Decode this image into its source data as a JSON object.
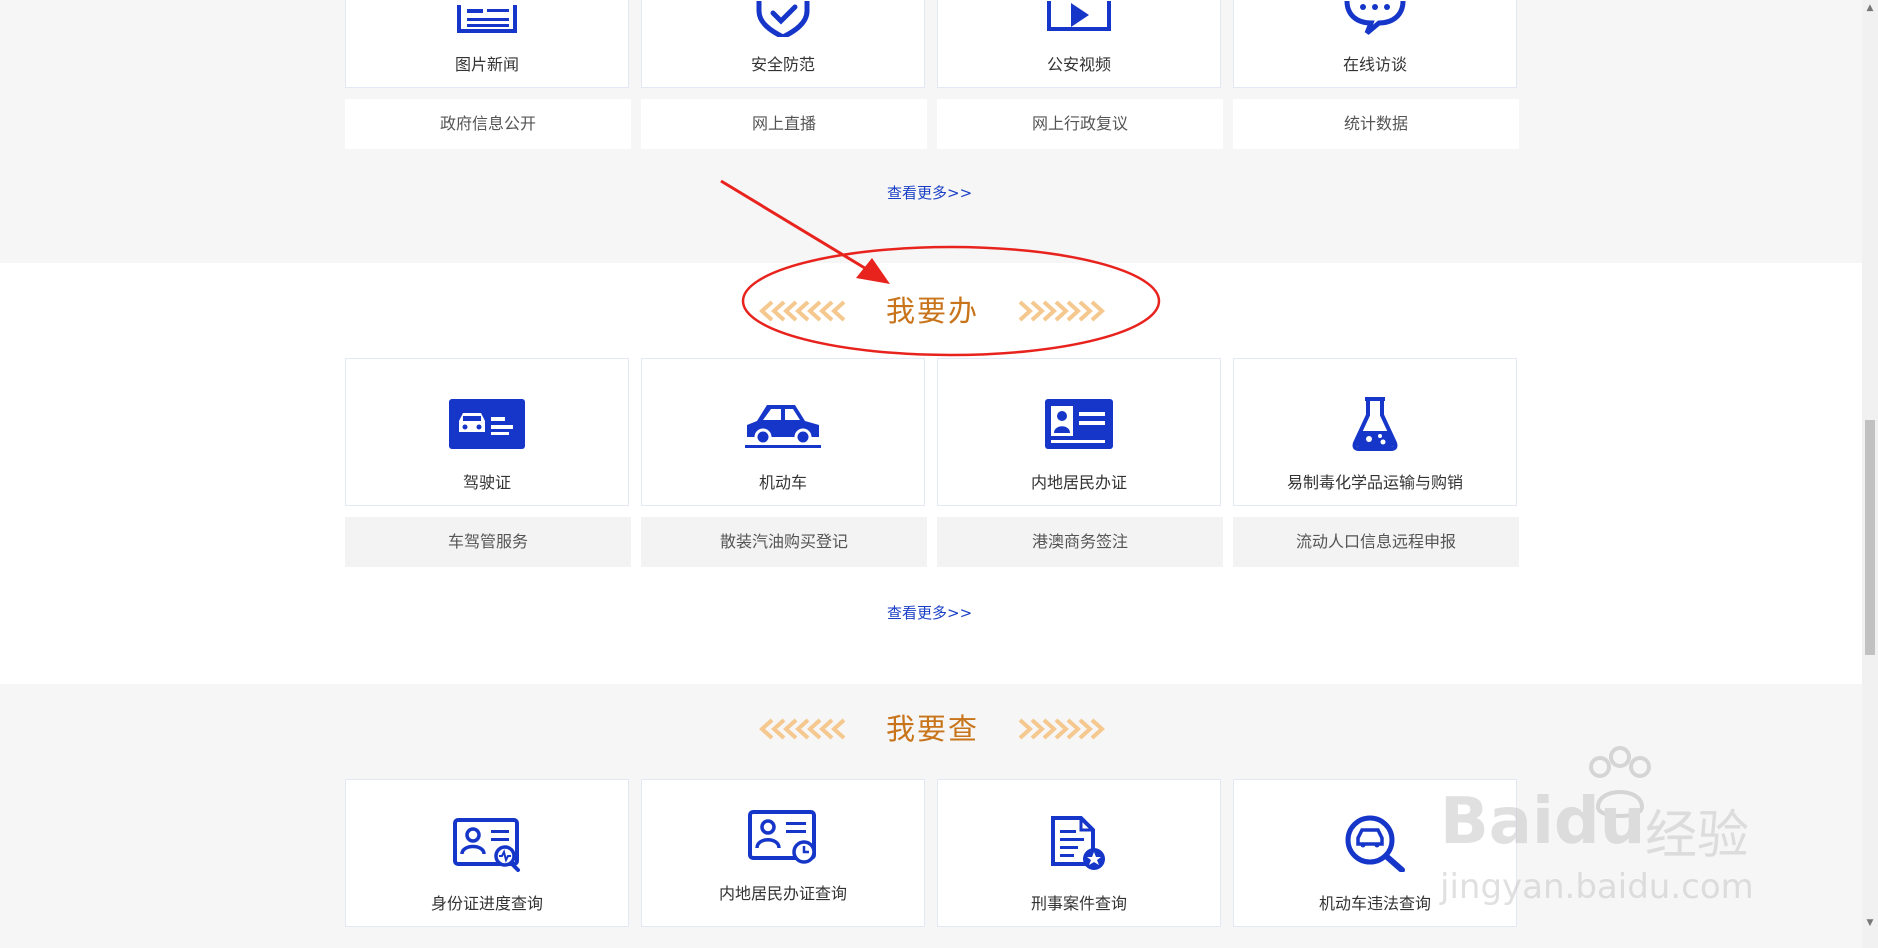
{
  "top_section": {
    "cards": [
      {
        "label": "图片新闻",
        "icon": "news-icon"
      },
      {
        "label": "安全防范",
        "icon": "shield-check-icon"
      },
      {
        "label": "公安视频",
        "icon": "video-play-icon"
      },
      {
        "label": "在线访谈",
        "icon": "chat-bubbles-icon"
      }
    ],
    "subitems": [
      "政府信息公开",
      "网上直播",
      "网上行政复议",
      "统计数据"
    ],
    "more_label": "查看更多>>"
  },
  "banli_section": {
    "title": "我要办",
    "cards": [
      {
        "label": "驾驶证",
        "icon": "driver-license-icon"
      },
      {
        "label": "机动车",
        "icon": "car-icon"
      },
      {
        "label": "内地居民办证",
        "icon": "id-card-icon"
      },
      {
        "label": "易制毒化学品运输与购销",
        "icon": "chemical-flask-icon"
      }
    ],
    "subitems": [
      "车驾管服务",
      "散装汽油购买登记",
      "港澳商务签注",
      "流动人口信息远程申报"
    ],
    "more_label": "查看更多>>"
  },
  "cha_section": {
    "title": "我要查",
    "cards": [
      {
        "label": "身份证进度查询",
        "icon": "id-progress-search-icon"
      },
      {
        "label": "内地居民办证查询",
        "icon": "id-clock-icon"
      },
      {
        "label": "刑事案件查询",
        "icon": "document-star-icon"
      },
      {
        "label": "机动车违法查询",
        "icon": "car-search-icon"
      }
    ]
  },
  "watermark": {
    "brand": "Baidu",
    "brand_cn": "经验",
    "url": "jingyan.baidu.com"
  },
  "colors": {
    "icon_blue": "#1536c9",
    "title_orange": "#c8741a",
    "chevron": "#f5c88f",
    "annotation_red": "#e8231e",
    "link_blue": "#1a3fc7"
  }
}
